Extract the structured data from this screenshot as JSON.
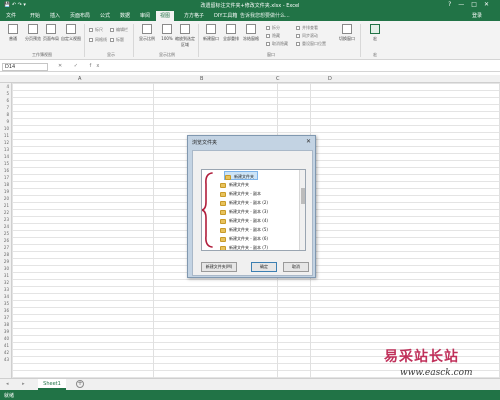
{
  "window": {
    "title": "改遗留标注文件夹+修改文件夹.xlsx - Excel",
    "quick_access": "💾 ↶ ↷ ▾",
    "controls": [
      "?",
      "—",
      "□",
      "✕"
    ]
  },
  "tabs": [
    {
      "label": "文件"
    },
    {
      "label": "开始"
    },
    {
      "label": "插入"
    },
    {
      "label": "页面布局"
    },
    {
      "label": "公式"
    },
    {
      "label": "数据"
    },
    {
      "label": "审阅"
    },
    {
      "label": "视图"
    },
    {
      "label": "方方格子"
    },
    {
      "label": "DIY工具箱"
    }
  ],
  "tell_me": "告诉我您想要做什么...",
  "signin": "登录",
  "ribbon": {
    "buttons": [
      {
        "label": "普通",
        "icon": "normal-view-icon"
      },
      {
        "label": "分页预览",
        "icon": "page-break-icon"
      },
      {
        "label": "页面布局",
        "icon": "page-layout-icon"
      },
      {
        "label": "自定义视图",
        "icon": "custom-view-icon"
      },
      {
        "label": "显示比例",
        "icon": "zoom-icon"
      },
      {
        "label": "100%",
        "icon": "zoom-100-icon"
      },
      {
        "label": "缩放到选定区域",
        "icon": "zoom-selection-icon"
      },
      {
        "label": "新建窗口",
        "icon": "new-window-icon"
      },
      {
        "label": "全部重排",
        "icon": "arrange-all-icon"
      },
      {
        "label": "冻结窗格",
        "icon": "freeze-panes-icon"
      },
      {
        "label": "切换窗口",
        "icon": "switch-window-icon"
      },
      {
        "label": "宏",
        "icon": "macro-icon"
      }
    ],
    "checks": [
      "标尺",
      "编辑栏",
      "网格线",
      "标题",
      "拆分",
      "隐藏",
      "取消隐藏",
      "并排查看",
      "同步滚动",
      "重设窗口位置"
    ],
    "groups": [
      "工作簿视图",
      "显示",
      "显示比例",
      "窗口",
      "宏"
    ]
  },
  "formula_bar": {
    "name_box": "D14",
    "icons": "✕ ✓ fx"
  },
  "grid": {
    "columns": [
      "A",
      "B",
      "C",
      "D"
    ],
    "rows": [
      "4",
      "5",
      "6",
      "7",
      "8",
      "9",
      "10",
      "11",
      "12",
      "13",
      "14",
      "15",
      "16",
      "17",
      "18",
      "19",
      "20",
      "21",
      "22",
      "23",
      "24",
      "25",
      "26",
      "27",
      "28",
      "29",
      "30",
      "31",
      "32",
      "33",
      "34",
      "35",
      "36",
      "37",
      "38",
      "39",
      "40",
      "41",
      "42",
      "43"
    ]
  },
  "sheets": {
    "nav": "◂ ▸",
    "tabs": [
      "Sheet1"
    ],
    "add": "+"
  },
  "status": {
    "ready": "就绪"
  },
  "dialog": {
    "title": "浏览文件夹",
    "close": "✕",
    "tree": [
      {
        "label": "新建文件夹",
        "selected": true
      },
      {
        "label": "新建文件夹"
      },
      {
        "label": "新建文件夹 - 副本"
      },
      {
        "label": "新建文件夹 - 副本 (2)"
      },
      {
        "label": "新建文件夹 - 副本 (3)"
      },
      {
        "label": "新建文件夹 - 副本 (4)"
      },
      {
        "label": "新建文件夹 - 副本 (5)"
      },
      {
        "label": "新建文件夹 - 副本 (6)"
      },
      {
        "label": "新建文件夹 - 副本 (7)"
      }
    ],
    "buttons": {
      "new_folder": "新建文件夹(M)",
      "ok": "确定",
      "cancel": "取消"
    }
  },
  "watermark": {
    "zh": "易采站长站",
    "en": "www.easck.com"
  },
  "colors": {
    "excel_green": "#217346",
    "dialog_frame": "#c3d3e3",
    "annotation": "#b01e3c"
  }
}
